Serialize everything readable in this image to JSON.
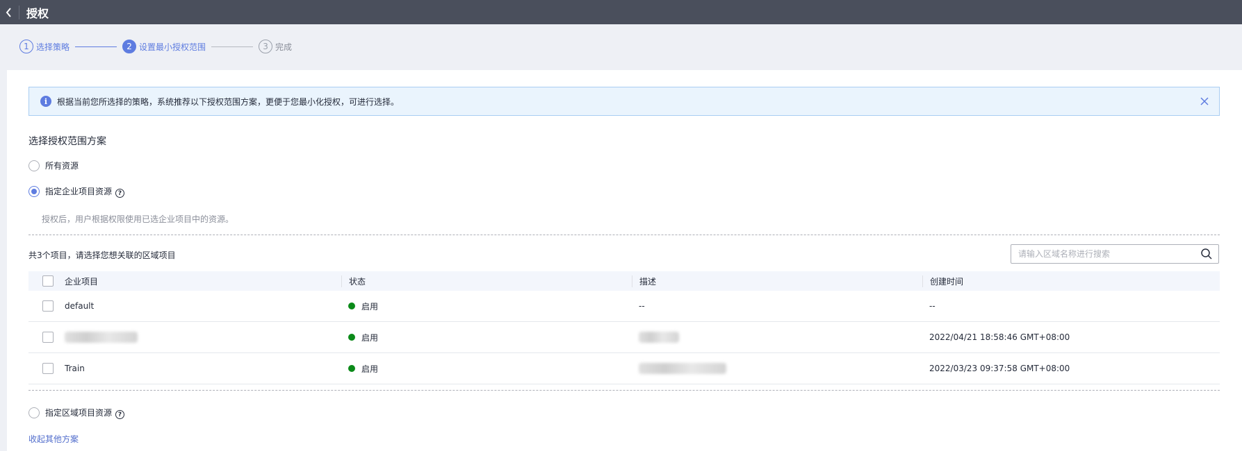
{
  "header": {
    "title": "授权"
  },
  "steps": [
    {
      "num": "1",
      "label": "选择策略",
      "state": "done"
    },
    {
      "num": "2",
      "label": "设置最小授权范围",
      "state": "active"
    },
    {
      "num": "3",
      "label": "完成",
      "state": "todo"
    }
  ],
  "notice": {
    "text": "根据当前您所选择的策略，系统推荐以下授权范围方案，更便于您最小化授权，可进行选择。"
  },
  "scope": {
    "title": "选择授权范围方案",
    "options": [
      {
        "label": "所有资源",
        "checked": false
      },
      {
        "label": "指定企业项目资源",
        "checked": true,
        "hint": "授权后，用户根据权限使用已选企业项目中的资源。"
      },
      {
        "label": "指定区域项目资源",
        "checked": false
      }
    ],
    "collapse_link": "收起其他方案"
  },
  "table": {
    "count_text": "共3个项目，请选择您想关联的区域项目",
    "search_placeholder": "请输入区域名称进行搜索",
    "columns": [
      "企业项目",
      "状态",
      "描述",
      "创建时间"
    ],
    "rows": [
      {
        "name": "default",
        "status": "启用",
        "description": "--",
        "created": "--"
      },
      {
        "name": "",
        "status": "启用",
        "description": "",
        "created": "2022/04/21 18:58:46 GMT+08:00"
      },
      {
        "name": "Train",
        "status": "启用",
        "description": "",
        "created": "2022/03/23 09:37:58 GMT+08:00"
      }
    ]
  },
  "colors": {
    "primary": "#5e7ce0",
    "status_enabled": "#0b8a19",
    "topbar": "#4a4f5c"
  }
}
